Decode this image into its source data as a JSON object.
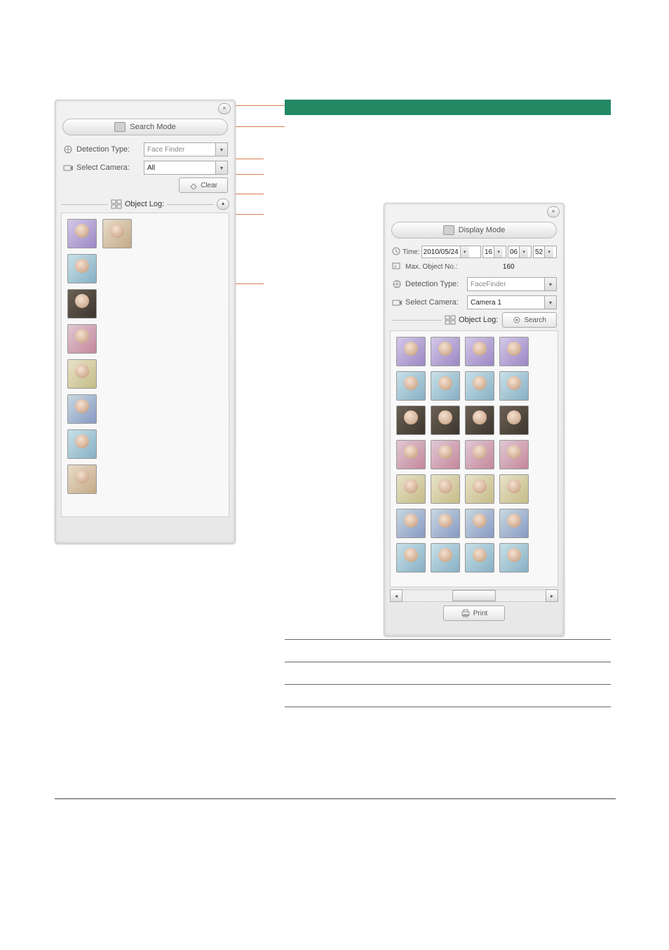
{
  "search_panel": {
    "close": "×",
    "mode_label": "Search Mode",
    "detection_type_label": "Detection Type:",
    "detection_type_value": "Face Finder",
    "select_camera_label": "Select Camera:",
    "select_camera_value": "All",
    "clear_label": "Clear",
    "object_log_label": "Object Log:",
    "collapse": "▴"
  },
  "display_panel": {
    "close": "×",
    "mode_label": "Display Mode",
    "time_label": "Time:",
    "time_date": "2010/05/24",
    "time_hour": "16",
    "time_min": "06",
    "time_sec": "52",
    "max_object_label": "Max. Object No.:",
    "max_object_value": "160",
    "detection_type_label": "Detection Type:",
    "detection_type_value": "FaceFinder",
    "select_camera_label": "Select Camera:",
    "select_camera_value": "Camera 1",
    "search_label": "Search",
    "object_log_label": "Object Log:",
    "scroll_left": "◂",
    "scroll_right": "▸",
    "print_label": "Print"
  },
  "chart_data": null
}
